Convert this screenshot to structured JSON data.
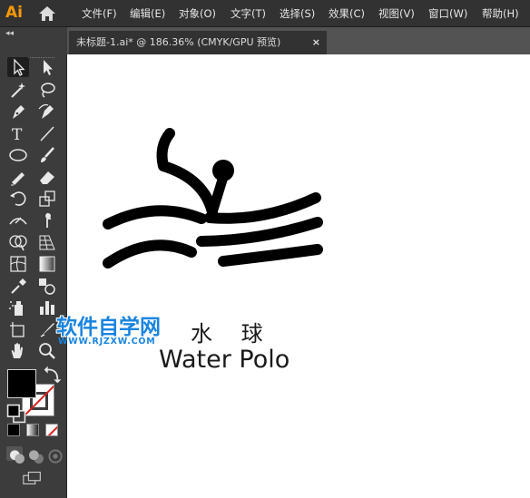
{
  "app": {
    "logo_text": "Ai"
  },
  "menu": {
    "items": [
      {
        "label": "文件(F)"
      },
      {
        "label": "编辑(E)"
      },
      {
        "label": "对象(O)"
      },
      {
        "label": "文字(T)"
      },
      {
        "label": "选择(S)"
      },
      {
        "label": "效果(C)"
      },
      {
        "label": "视图(V)"
      },
      {
        "label": "窗口(W)"
      },
      {
        "label": "帮助(H)"
      }
    ]
  },
  "panel": {
    "collapse_glyph": "◂◂"
  },
  "document_tab": {
    "title": "未标题-1.ai* @ 186.36% (CMYK/GPU 预览)",
    "close_glyph": "×"
  },
  "artwork": {
    "label_chinese": "水 球",
    "label_english": "Water Polo"
  },
  "watermark": {
    "title": "软件自学网",
    "url": "WWW.RJZXW.COM"
  },
  "colors": {
    "menubar_bg": "#323232",
    "toolbar_bg": "#3c3c3c",
    "logo": "#ff9a00",
    "watermark": "#1a84e0",
    "fill": "#000000",
    "stroke_none": "#e01e1e"
  },
  "icons": [
    "home-icon",
    "selection-tool-icon",
    "direct-selection-tool-icon",
    "magic-wand-icon",
    "lasso-icon",
    "pen-tool-icon",
    "curvature-tool-icon",
    "type-tool-icon",
    "line-segment-tool-icon",
    "ellipse-tool-icon",
    "paintbrush-icon",
    "shaper-tool-icon",
    "eraser-icon",
    "rotate-tool-icon",
    "scale-tool-icon",
    "width-tool-icon",
    "puppet-warp-icon",
    "shape-builder-icon",
    "perspective-grid-icon",
    "mesh-tool-icon",
    "gradient-tool-icon",
    "eyedropper-icon",
    "blend-tool-icon",
    "symbol-sprayer-icon",
    "column-graph-icon",
    "artboard-tool-icon",
    "slice-tool-icon",
    "hand-tool-icon",
    "zoom-tool-icon",
    "swap-fill-stroke-icon",
    "default-colors-icon",
    "color-mode-icon",
    "gradient-mode-icon",
    "none-mode-icon",
    "draw-normal-icon",
    "draw-behind-icon",
    "draw-inside-icon",
    "screen-mode-icon"
  ]
}
